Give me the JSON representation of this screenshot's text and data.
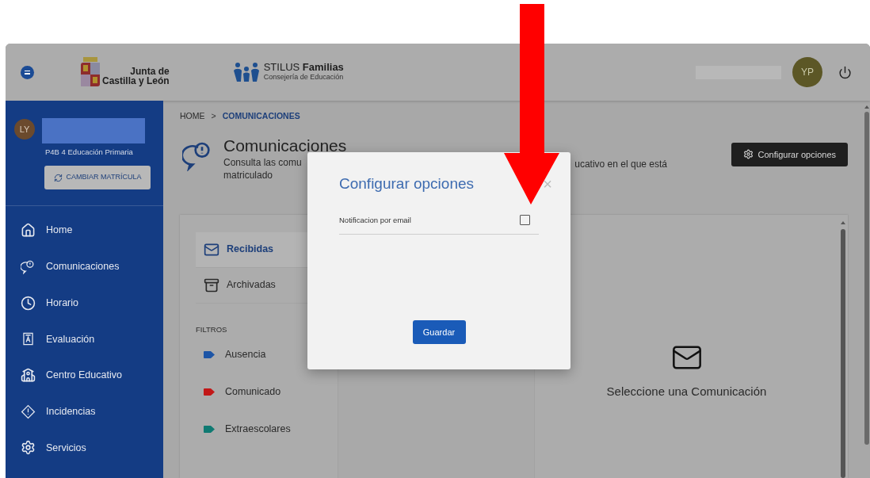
{
  "header": {
    "brand_line_1": "Junta de",
    "brand_line_2": "Castilla y León",
    "app_name_plain": "STILUS ",
    "app_name_bold": "Familias",
    "app_subtitle": "Consejería de Educación",
    "user_initials": "YP"
  },
  "sidebar": {
    "student_initials": "LY",
    "student_group": "P4B 4 Educación Primaria",
    "change_button": "CAMBIAR MATRÍCULA",
    "items": [
      {
        "label": "Home",
        "kind": "home"
      },
      {
        "label": "Comunicaciones",
        "kind": "chat"
      },
      {
        "label": "Horario",
        "kind": "clock"
      },
      {
        "label": "Evaluación",
        "kind": "grade"
      },
      {
        "label": "Centro Educativo",
        "kind": "school"
      },
      {
        "label": "Incidencias",
        "kind": "alert"
      },
      {
        "label": "Servicios",
        "kind": "gear"
      }
    ]
  },
  "breadcrumb": [
    {
      "label": "HOME",
      "selected": false
    },
    {
      "label": "COMUNICACIONES",
      "selected": true
    }
  ],
  "breadcrumb_separator": ">",
  "page": {
    "title": "Comunicaciones",
    "subtitle_left_1": "Consulta las comu",
    "subtitle_left_2": "matriculado",
    "subtitle_right": "ucativo en el que está",
    "config_button": "Configurar opciones"
  },
  "folders": [
    {
      "label": "Recibidas",
      "kind": "inbox",
      "selected": true
    },
    {
      "label": "Archivadas",
      "kind": "archive",
      "selected": false
    }
  ],
  "filters_heading": "FILTROS",
  "filters": [
    {
      "label": "Ausencia",
      "color": "#1d55a6"
    },
    {
      "label": "Comunicado",
      "color": "#c21818"
    },
    {
      "label": "Extraescolares",
      "color": "#0f7a72"
    }
  ],
  "empty_message": "Seleccione una Comunicación",
  "dialog": {
    "title": "Configurar opciones",
    "close": "×",
    "options": [
      {
        "label": "Notificacion por email",
        "checked": false
      }
    ],
    "save_button": "Guardar"
  }
}
